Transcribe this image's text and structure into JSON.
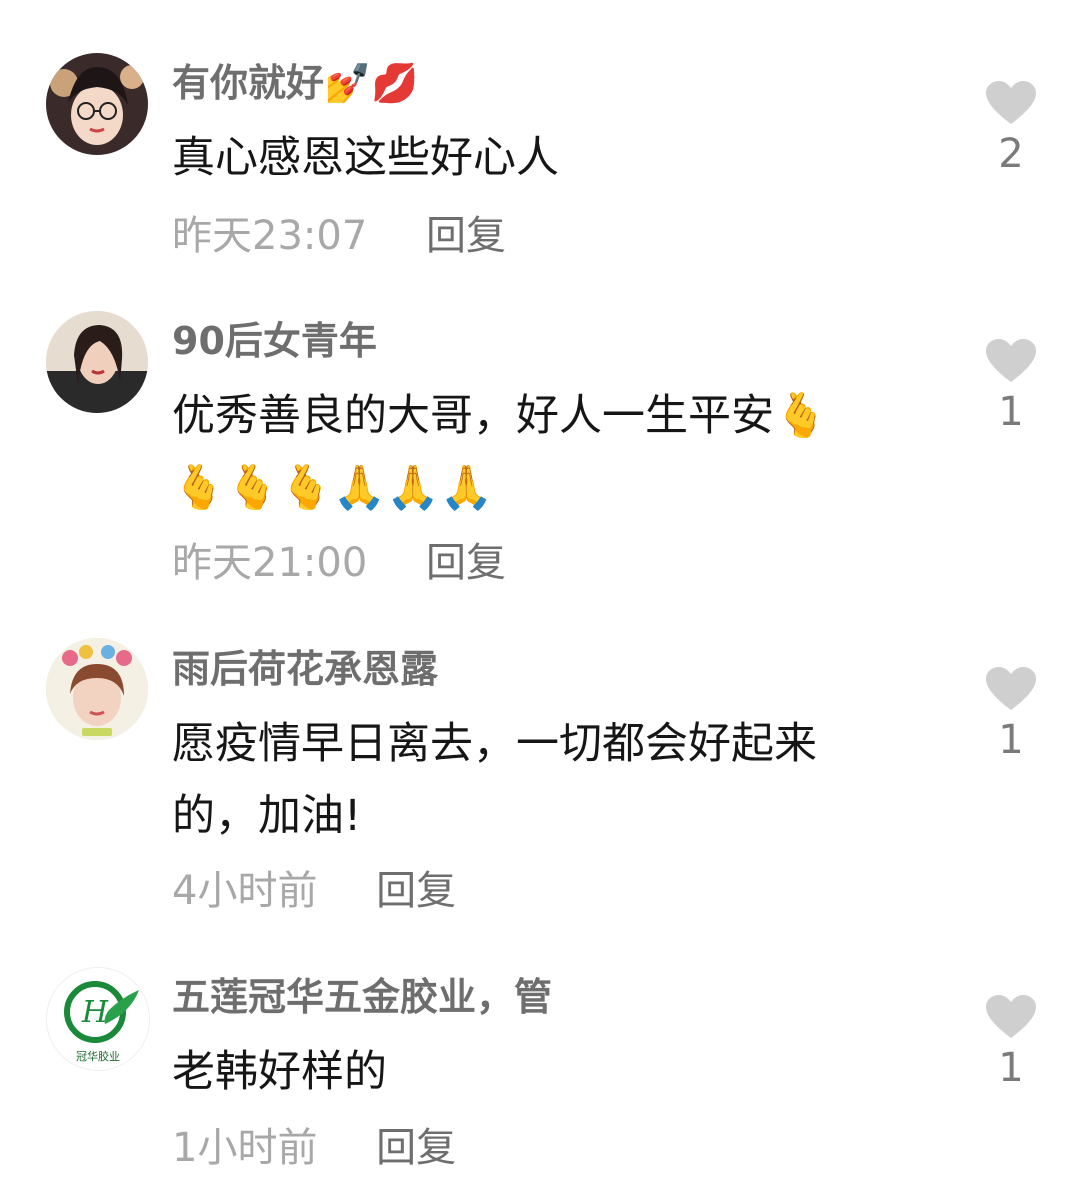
{
  "comments": [
    {
      "username": "有你就好💅💋",
      "text": "真心感恩这些好心人",
      "time": "昨天23:07",
      "reply_label": "回复",
      "likes": "2",
      "avatar_icon": "avatar-woman-glasses"
    },
    {
      "username": "90后女青年",
      "text": "优秀善良的大哥，好人一生平安🫰\n🫰🫰🫰🙏🙏🙏",
      "time": "昨天21:00",
      "reply_label": "回复",
      "likes": "1",
      "avatar_icon": "avatar-woman-portrait"
    },
    {
      "username": "雨后荷花承恩露",
      "text": "愿疫情早日离去，一切都会好起来\n的，加油!",
      "time": "4小时前",
      "reply_label": "回复",
      "likes": "1",
      "avatar_icon": "avatar-woman-flowers"
    },
    {
      "username": "五莲冠华五金胶业，管",
      "text": "老韩好样的",
      "time": "1小时前",
      "reply_label": "回复",
      "likes": "1",
      "avatar_icon": "avatar-company-logo",
      "avatar_logo_text": "冠华胶业"
    }
  ],
  "colors": {
    "username": "#6e6e6e",
    "body": "#161616",
    "time": "#a8a8a8",
    "reply": "#6e6e6e",
    "heart": "#cfcfcf",
    "count": "#7a7a7a"
  },
  "icons": {
    "like": "heart-icon"
  }
}
